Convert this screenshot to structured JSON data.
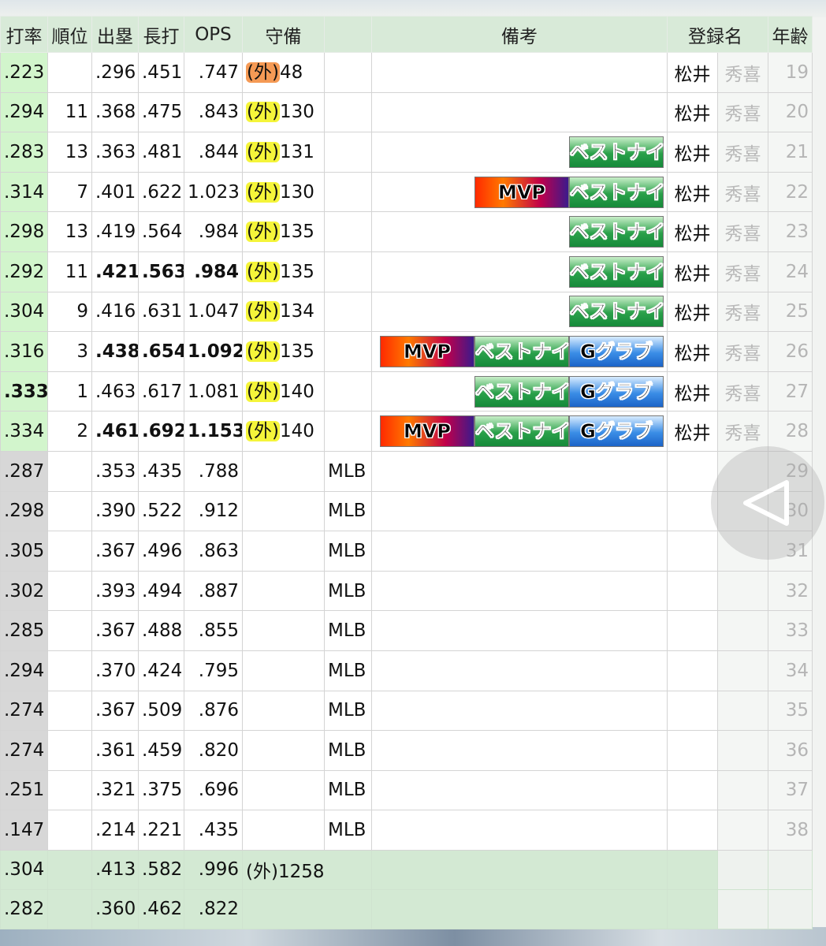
{
  "headers": {
    "avg": "打率",
    "rank": "順位",
    "obp": "出塁",
    "slg": "長打",
    "ops": "OPS",
    "def": "守備",
    "league": "",
    "notes": "備考",
    "reg_name": "登録名",
    "age": "年齢"
  },
  "rows": [
    {
      "avg": ".223",
      "rank": "",
      "obp": ".296",
      "slg": ".451",
      "ops": ".747",
      "pos": "(外)",
      "games": "48",
      "league": "",
      "badges": [],
      "last": "松井",
      "first": "秀喜",
      "age": "19",
      "bold": [],
      "avg_bold": false,
      "avg_bg": "green",
      "pos_color": "orange"
    },
    {
      "avg": ".294",
      "rank": "11",
      "obp": ".368",
      "slg": ".475",
      "ops": ".843",
      "pos": "(外)",
      "games": "130",
      "league": "",
      "badges": [],
      "last": "松井",
      "first": "秀喜",
      "age": "20",
      "bold": [],
      "avg_bold": false,
      "avg_bg": "green",
      "pos_color": "yellow"
    },
    {
      "avg": ".283",
      "rank": "13",
      "obp": ".363",
      "slg": ".481",
      "ops": ".844",
      "pos": "(外)",
      "games": "131",
      "league": "",
      "badges": [
        "ベストナイン"
      ],
      "last": "松井",
      "first": "秀喜",
      "age": "21",
      "bold": [],
      "avg_bold": false,
      "avg_bg": "green",
      "pos_color": "yellow"
    },
    {
      "avg": ".314",
      "rank": "7",
      "obp": ".401",
      "slg": ".622",
      "ops": "1.023",
      "pos": "(外)",
      "games": "130",
      "league": "",
      "badges": [
        "MVP",
        "ベストナイン"
      ],
      "last": "松井",
      "first": "秀喜",
      "age": "22",
      "bold": [],
      "avg_bold": false,
      "avg_bg": "green",
      "pos_color": "yellow"
    },
    {
      "avg": ".298",
      "rank": "13",
      "obp": ".419",
      "slg": ".564",
      "ops": ".984",
      "pos": "(外)",
      "games": "135",
      "league": "",
      "badges": [
        "ベストナイン"
      ],
      "last": "松井",
      "first": "秀喜",
      "age": "23",
      "bold": [],
      "avg_bold": false,
      "avg_bg": "green",
      "pos_color": "yellow"
    },
    {
      "avg": ".292",
      "rank": "11",
      "obp": ".421",
      "slg": ".563",
      "ops": ".984",
      "pos": "(外)",
      "games": "135",
      "league": "",
      "badges": [
        "ベストナイン"
      ],
      "last": "松井",
      "first": "秀喜",
      "age": "24",
      "bold": [
        "obp",
        "slg",
        "ops"
      ],
      "avg_bold": false,
      "avg_bg": "green",
      "pos_color": "yellow"
    },
    {
      "avg": ".304",
      "rank": "9",
      "obp": ".416",
      "slg": ".631",
      "ops": "1.047",
      "pos": "(外)",
      "games": "134",
      "league": "",
      "badges": [
        "ベストナイン"
      ],
      "last": "松井",
      "first": "秀喜",
      "age": "25",
      "bold": [],
      "avg_bold": false,
      "avg_bg": "green",
      "pos_color": "yellow"
    },
    {
      "avg": ".316",
      "rank": "3",
      "obp": ".438",
      "slg": ".654",
      "ops": "1.092",
      "pos": "(外)",
      "games": "135",
      "league": "",
      "badges": [
        "MVP",
        "ベストナイン",
        "Gグラブ"
      ],
      "last": "松井",
      "first": "秀喜",
      "age": "26",
      "bold": [
        "obp",
        "slg",
        "ops"
      ],
      "avg_bold": false,
      "avg_bg": "green",
      "pos_color": "yellow"
    },
    {
      "avg": ".333",
      "rank": "1",
      "obp": ".463",
      "slg": ".617",
      "ops": "1.081",
      "pos": "(外)",
      "games": "140",
      "league": "",
      "badges": [
        "ベストナイン",
        "Gグラブ"
      ],
      "last": "松井",
      "first": "秀喜",
      "age": "27",
      "bold": [],
      "avg_bold": true,
      "avg_bg": "green",
      "pos_color": "yellow"
    },
    {
      "avg": ".334",
      "rank": "2",
      "obp": ".461",
      "slg": ".692",
      "ops": "1.153",
      "pos": "(外)",
      "games": "140",
      "league": "",
      "badges": [
        "MVP",
        "ベストナイン",
        "Gグラブ"
      ],
      "last": "松井",
      "first": "秀喜",
      "age": "28",
      "bold": [
        "obp",
        "slg",
        "ops"
      ],
      "avg_bold": false,
      "avg_bg": "green",
      "pos_color": "yellow"
    },
    {
      "avg": ".287",
      "rank": "",
      "obp": ".353",
      "slg": ".435",
      "ops": ".788",
      "pos": "",
      "games": "",
      "league": "MLB",
      "badges": [],
      "last": "",
      "first": "",
      "age": "29",
      "bold": [],
      "avg_bold": false,
      "avg_bg": "gray",
      "pos_color": ""
    },
    {
      "avg": ".298",
      "rank": "",
      "obp": ".390",
      "slg": ".522",
      "ops": ".912",
      "pos": "",
      "games": "",
      "league": "MLB",
      "badges": [],
      "last": "",
      "first": "",
      "age": "30",
      "bold": [],
      "avg_bold": false,
      "avg_bg": "gray",
      "pos_color": ""
    },
    {
      "avg": ".305",
      "rank": "",
      "obp": ".367",
      "slg": ".496",
      "ops": ".863",
      "pos": "",
      "games": "",
      "league": "MLB",
      "badges": [],
      "last": "",
      "first": "",
      "age": "31",
      "bold": [],
      "avg_bold": false,
      "avg_bg": "gray",
      "pos_color": ""
    },
    {
      "avg": ".302",
      "rank": "",
      "obp": ".393",
      "slg": ".494",
      "ops": ".887",
      "pos": "",
      "games": "",
      "league": "MLB",
      "badges": [],
      "last": "",
      "first": "",
      "age": "32",
      "bold": [],
      "avg_bold": false,
      "avg_bg": "gray",
      "pos_color": ""
    },
    {
      "avg": ".285",
      "rank": "",
      "obp": ".367",
      "slg": ".488",
      "ops": ".855",
      "pos": "",
      "games": "",
      "league": "MLB",
      "badges": [],
      "last": "",
      "first": "",
      "age": "33",
      "bold": [],
      "avg_bold": false,
      "avg_bg": "gray",
      "pos_color": ""
    },
    {
      "avg": ".294",
      "rank": "",
      "obp": ".370",
      "slg": ".424",
      "ops": ".795",
      "pos": "",
      "games": "",
      "league": "MLB",
      "badges": [],
      "last": "",
      "first": "",
      "age": "34",
      "bold": [],
      "avg_bold": false,
      "avg_bg": "gray",
      "pos_color": ""
    },
    {
      "avg": ".274",
      "rank": "",
      "obp": ".367",
      "slg": ".509",
      "ops": ".876",
      "pos": "",
      "games": "",
      "league": "MLB",
      "badges": [],
      "last": "",
      "first": "",
      "age": "35",
      "bold": [],
      "avg_bold": false,
      "avg_bg": "gray",
      "pos_color": ""
    },
    {
      "avg": ".274",
      "rank": "",
      "obp": ".361",
      "slg": ".459",
      "ops": ".820",
      "pos": "",
      "games": "",
      "league": "MLB",
      "badges": [],
      "last": "",
      "first": "",
      "age": "36",
      "bold": [],
      "avg_bold": false,
      "avg_bg": "gray",
      "pos_color": ""
    },
    {
      "avg": ".251",
      "rank": "",
      "obp": ".321",
      "slg": ".375",
      "ops": ".696",
      "pos": "",
      "games": "",
      "league": "MLB",
      "badges": [],
      "last": "",
      "first": "",
      "age": "37",
      "bold": [],
      "avg_bold": false,
      "avg_bg": "gray",
      "pos_color": ""
    },
    {
      "avg": ".147",
      "rank": "",
      "obp": ".214",
      "slg": ".221",
      "ops": ".435",
      "pos": "",
      "games": "",
      "league": "MLB",
      "badges": [],
      "last": "",
      "first": "",
      "age": "38",
      "bold": [],
      "avg_bold": false,
      "avg_bg": "gray",
      "pos_color": ""
    }
  ],
  "totals": [
    {
      "avg": ".304",
      "obp": ".413",
      "slg": ".582",
      "ops": ".996",
      "def": "(外)1258"
    },
    {
      "avg": ".282",
      "obp": ".360",
      "slg": ".462",
      "ops": ".822",
      "def": ""
    }
  ],
  "badge_colors": {
    "MVP": "mvp",
    "ベストナイン": "b9",
    "Gグラブ": "gg"
  },
  "overlay": {
    "icon": "back-triangle-icon",
    "color": "#ffffff"
  }
}
